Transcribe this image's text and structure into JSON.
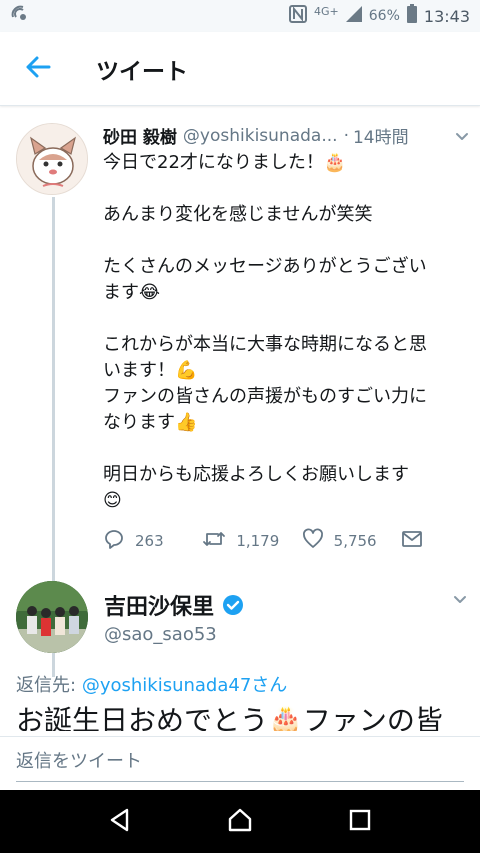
{
  "status_bar": {
    "network": "4G+",
    "battery": "66%",
    "time": "13:43"
  },
  "app_bar": {
    "title": "ツイート",
    "back_icon": "arrow-left-icon"
  },
  "tweet": {
    "author_name": "砂田 毅樹",
    "handle": "@yoshikisunada...",
    "separator": "·",
    "time": "14時間",
    "paragraphs": [
      [
        "今日で22才になりました！🎂"
      ],
      [
        "あんまり変化を感じませんが笑笑"
      ],
      [
        "たくさんのメッセージありがとうござい",
        "ます😂"
      ],
      [
        "これからが本当に大事な時期になると思",
        "います！💪",
        "ファンの皆さんの声援がものすごい力に",
        "なります👍"
      ],
      [
        "明日からも応援よろしくお願いします",
        "😊"
      ]
    ],
    "reply_count": "263",
    "retweet_count": "1,179",
    "like_count": "5,756",
    "colors": {
      "accent": "#1da1f2",
      "muted": "#657786"
    }
  },
  "reply_tweet": {
    "author_name": "吉田沙保里",
    "handle": "@sao_sao53",
    "reply_to_label": "返信先:",
    "reply_to_user": "@yoshikisunada47さん",
    "text": "お誕生日おめでとう🎂ファンの皆"
  },
  "reply_bar": {
    "placeholder": "返信をツイート"
  },
  "nav_bar": {
    "back": "nav-back-icon",
    "home": "nav-home-icon",
    "recents": "nav-recents-icon"
  }
}
